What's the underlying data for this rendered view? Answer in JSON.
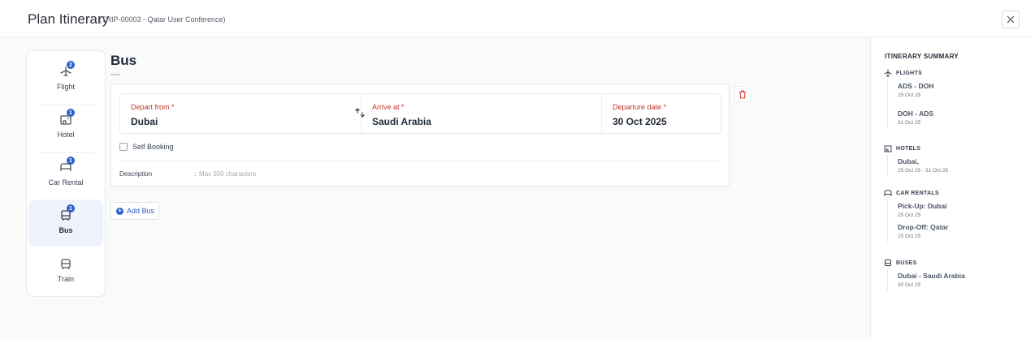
{
  "header": {
    "title": "Plan Itinerary",
    "subtitle": "(TRIP-00003 - Qatar User Conference)"
  },
  "sidebar": {
    "items": [
      {
        "label": "Flight",
        "badge": "2"
      },
      {
        "label": "Hotel",
        "badge": "1"
      },
      {
        "label": "Car Rental",
        "badge": "1"
      },
      {
        "label": "Bus",
        "badge": "1",
        "active": true
      },
      {
        "label": "Train"
      }
    ]
  },
  "main": {
    "section_title": "Bus",
    "card": {
      "depart_label": "Depart from *",
      "depart_value": "Dubai",
      "arrive_label": "Arrive at *",
      "arrive_value": "Saudi Arabia",
      "date_label": "Departure date *",
      "date_value": "30 Oct 2025",
      "self_booking_label": "Self Booking",
      "self_booking_checked": false,
      "description_label": "Description",
      "description_colon": ":",
      "description_placeholder": "Max 500 characters"
    },
    "add_button_label": "Add Bus"
  },
  "summary": {
    "title": "ITINERARY SUMMARY",
    "flights": {
      "heading": "FLIGHTS",
      "entries": [
        {
          "title": "ADS - DOH",
          "date": "25 Oct 25"
        },
        {
          "title": "DOH - ADS",
          "date": "31 Oct 25"
        }
      ]
    },
    "hotels": {
      "heading": "HOTELS",
      "entries": [
        {
          "title": "Dubai,",
          "date": "25 Oct 25 - 31 Oct 25"
        }
      ]
    },
    "car_rentals": {
      "heading": "CAR RENTALS",
      "entries": [
        {
          "title": "Pick-Up: Dubai",
          "date": "25 Oct 25"
        },
        {
          "title": "Drop-Off: Qatar",
          "date": "25 Oct 25"
        }
      ]
    },
    "buses": {
      "heading": "BUSES",
      "entries": [
        {
          "title": "Dubai - Saudi Arabia",
          "date": "30 Oct 25"
        }
      ]
    }
  },
  "colors": {
    "accent": "#2f5fc9",
    "required_label": "#c0392b",
    "delete": "#d64545"
  }
}
